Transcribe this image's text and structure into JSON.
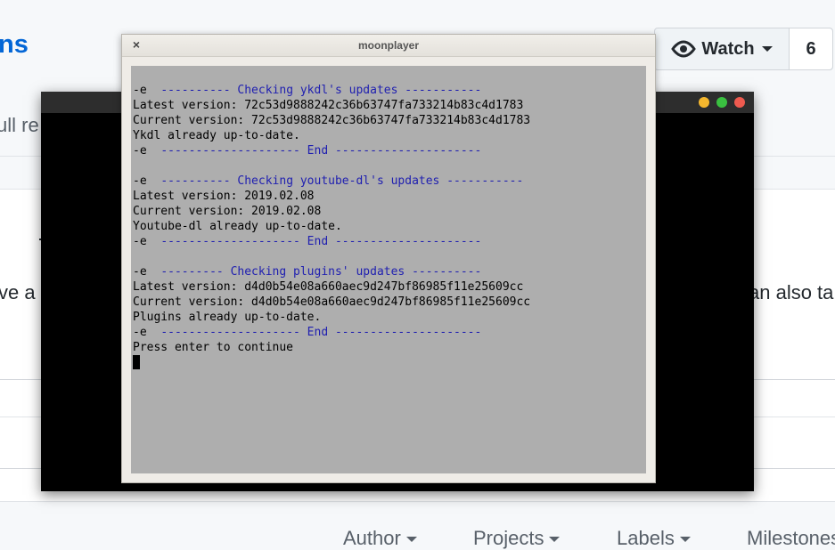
{
  "background": {
    "title_fragment": "ns",
    "tab_fragment": "ull re",
    "text_left": "ve a",
    "text_right": "an also ta",
    "watch_label": "Watch",
    "watch_count": "6",
    "filters": [
      {
        "label": "Author"
      },
      {
        "label": "Projects"
      },
      {
        "label": "Labels"
      },
      {
        "label": "Milestones"
      }
    ]
  },
  "window": {
    "title": "moonplayer",
    "close_symbol": "×"
  },
  "console": {
    "lines": [
      {
        "prefix": "-e  ",
        "text": "---------- Checking ykdl's updates -----------",
        "blue": true
      },
      {
        "prefix": "",
        "text": "Latest version: 72c53d9888242c36b63747fa733214b83c4d1783",
        "blue": false
      },
      {
        "prefix": "",
        "text": "Current version: 72c53d9888242c36b63747fa733214b83c4d1783",
        "blue": false
      },
      {
        "prefix": "",
        "text": "Ykdl already up-to-date.",
        "blue": false
      },
      {
        "prefix": "-e  ",
        "text": "-------------------- End ---------------------",
        "blue": true
      },
      {
        "prefix": "",
        "text": "",
        "blue": false
      },
      {
        "prefix": "-e  ",
        "text": "---------- Checking youtube-dl's updates -----------",
        "blue": true
      },
      {
        "prefix": "",
        "text": "Latest version: 2019.02.08",
        "blue": false
      },
      {
        "prefix": "",
        "text": "Current version: 2019.02.08",
        "blue": false
      },
      {
        "prefix": "",
        "text": "Youtube-dl already up-to-date.",
        "blue": false
      },
      {
        "prefix": "-e  ",
        "text": "-------------------- End ---------------------",
        "blue": true
      },
      {
        "prefix": "",
        "text": "",
        "blue": false
      },
      {
        "prefix": "-e  ",
        "text": "--------- Checking plugins' updates ----------",
        "blue": true
      },
      {
        "prefix": "",
        "text": "Latest version: d4d0b54e08a660aec9d247bf86985f11e25609cc",
        "blue": false
      },
      {
        "prefix": "",
        "text": "Current version: d4d0b54e08a660aec9d247bf86985f11e25609cc",
        "blue": false
      },
      {
        "prefix": "",
        "text": "Plugins already up-to-date.",
        "blue": false
      },
      {
        "prefix": "-e  ",
        "text": "-------------------- End ---------------------",
        "blue": true
      },
      {
        "prefix": "",
        "text": "Press enter to continue",
        "blue": false
      }
    ]
  },
  "colors": {
    "console_bg": "#aeaeae",
    "console_blue": "#2020b0",
    "link_blue": "#0366d6"
  }
}
